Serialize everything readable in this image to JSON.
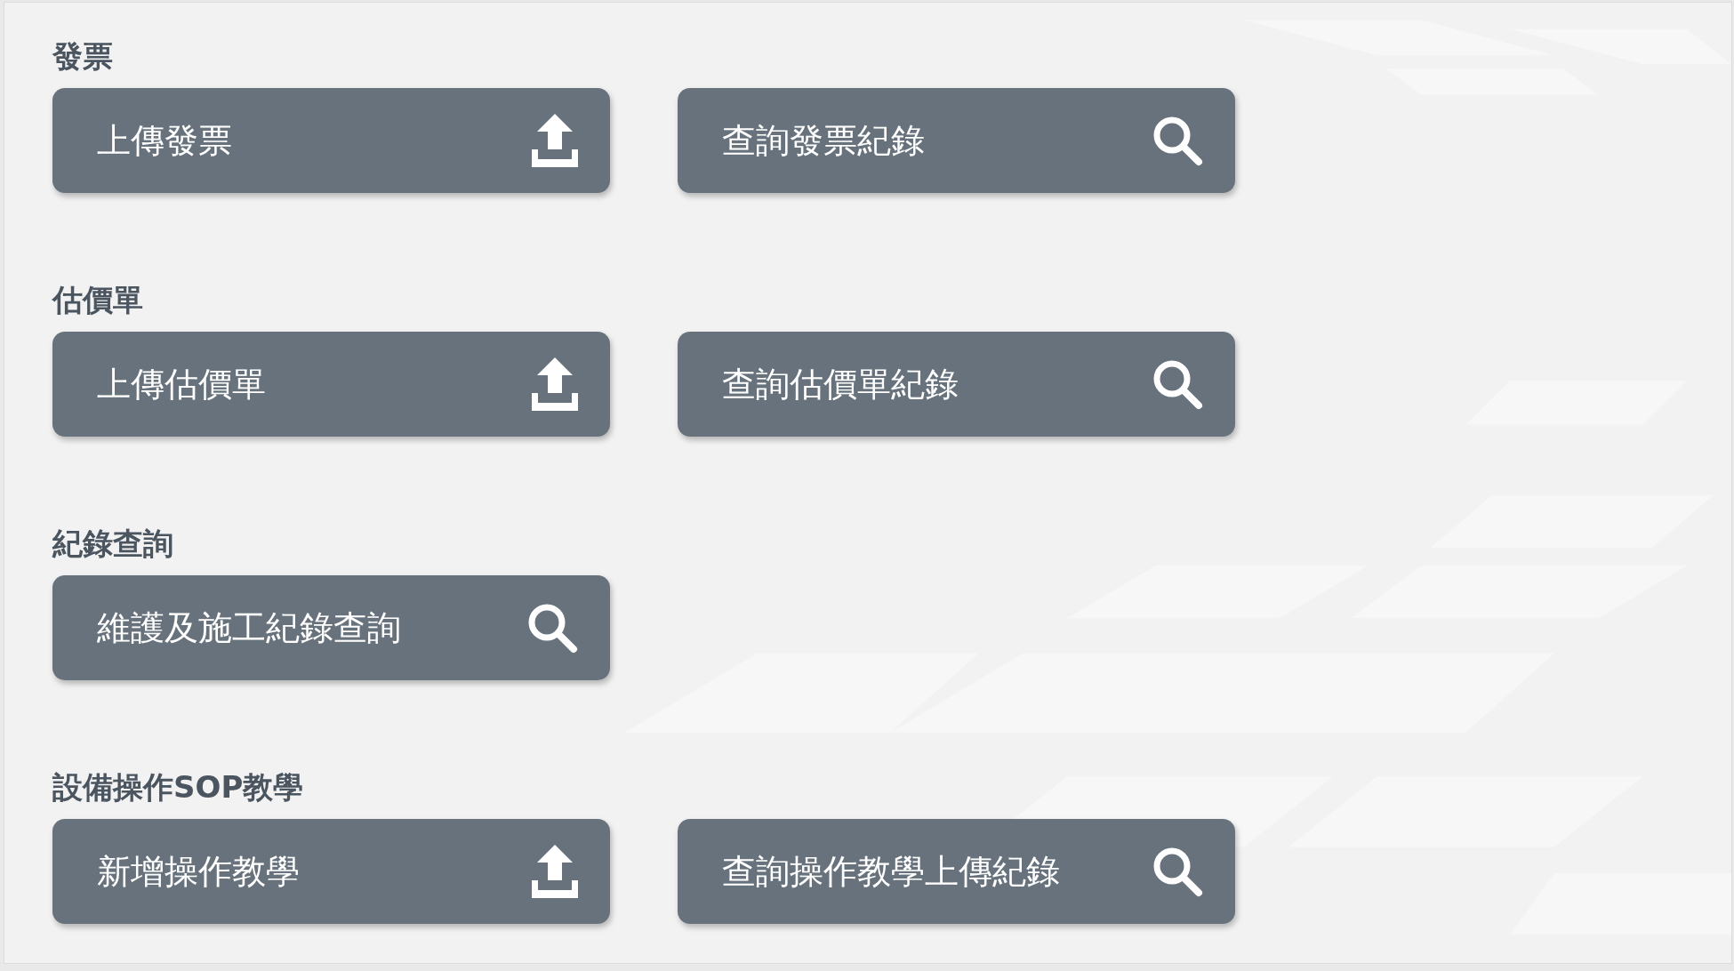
{
  "sections": [
    {
      "title": "發票",
      "buttons": [
        {
          "label": "上傳發票",
          "kind": "upload"
        },
        {
          "label": "查詢發票紀錄",
          "kind": "search"
        }
      ]
    },
    {
      "title": "估價單",
      "buttons": [
        {
          "label": "上傳估價單",
          "kind": "upload"
        },
        {
          "label": "查詢估價單紀錄",
          "kind": "search"
        }
      ]
    },
    {
      "title": "紀錄查詢",
      "buttons": [
        {
          "label": "維護及施工紀錄查詢",
          "kind": "search"
        }
      ]
    },
    {
      "title": "設備操作SOP教學",
      "buttons": [
        {
          "label": "新增操作教學",
          "kind": "upload"
        },
        {
          "label": "查詢操作教學上傳紀錄",
          "kind": "search"
        }
      ]
    }
  ]
}
